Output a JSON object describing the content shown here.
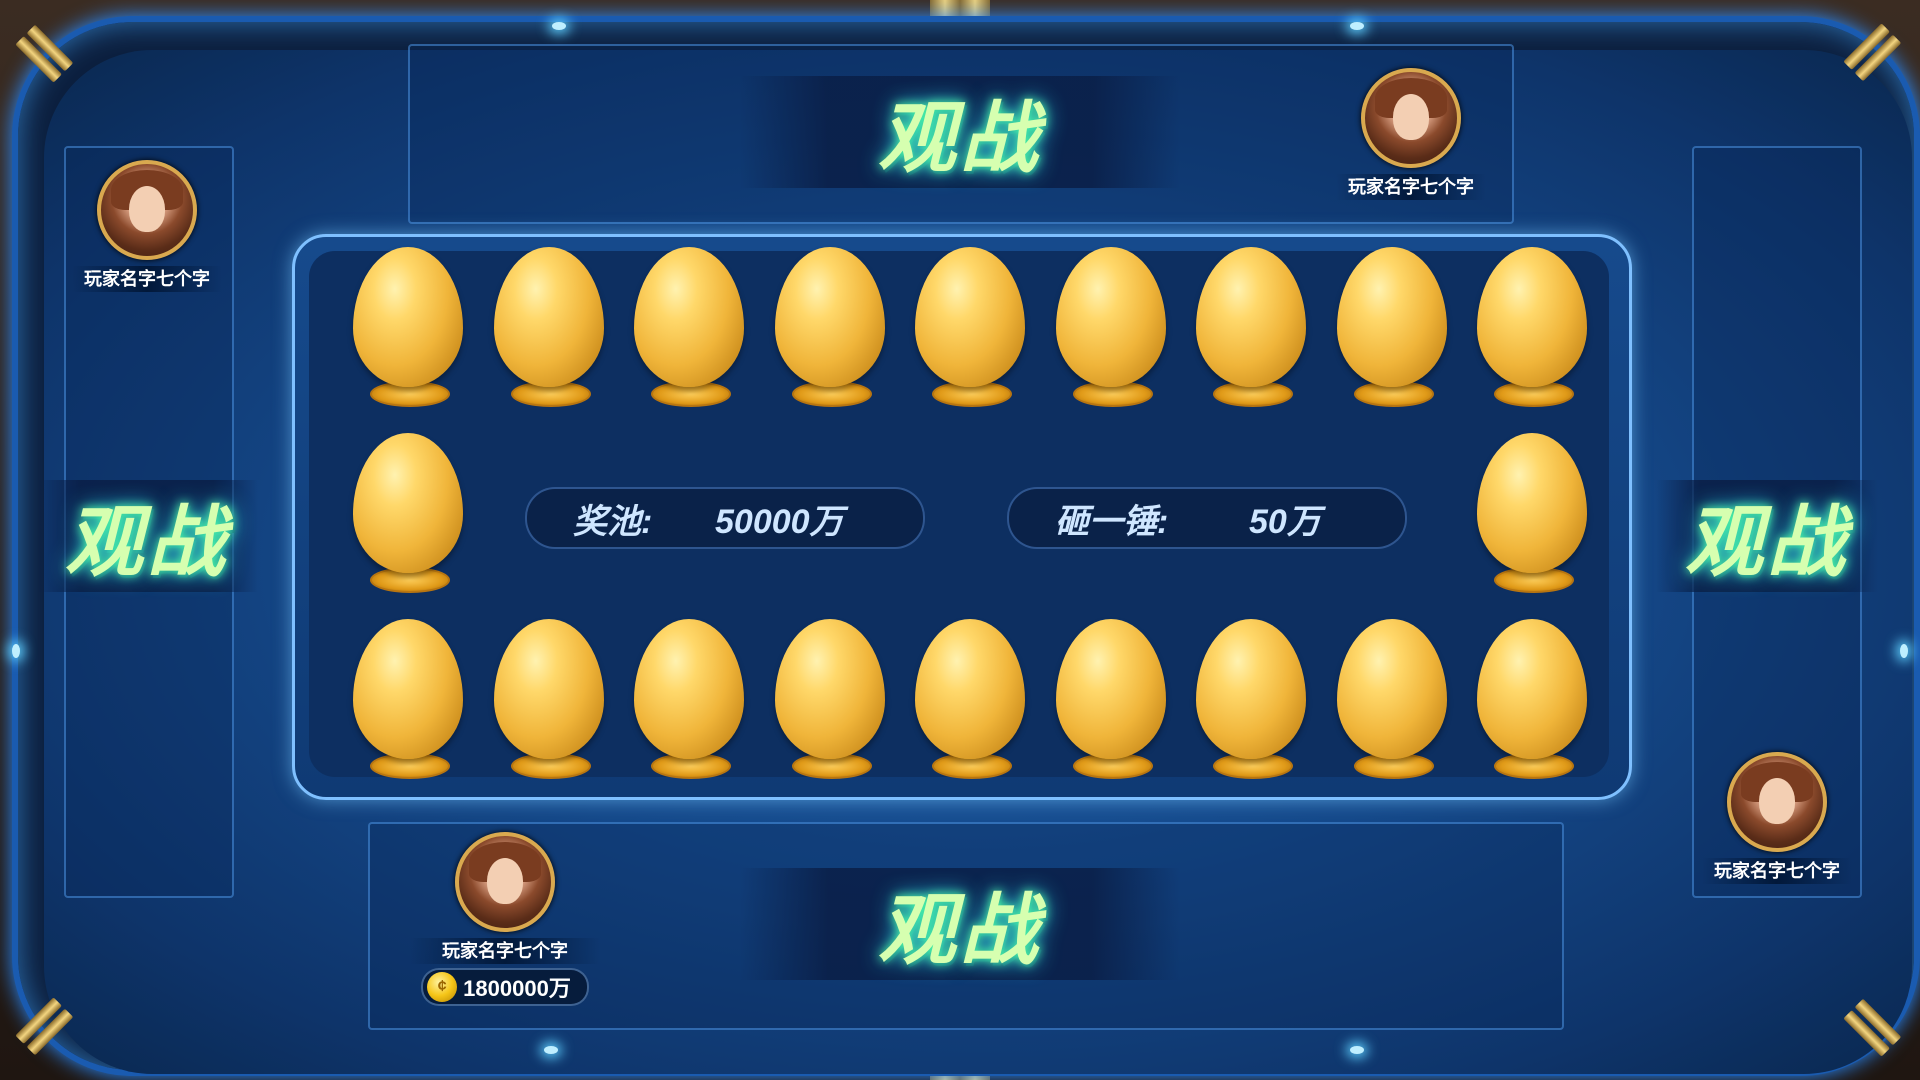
{
  "spectate_label": "观战",
  "players": {
    "top_right": {
      "name": "玩家名字七个字"
    },
    "left": {
      "name": "玩家名字七个字"
    },
    "right": {
      "name": "玩家名字七个字"
    },
    "bottom": {
      "name": "玩家名字七个字",
      "coins": "1800000万"
    }
  },
  "board": {
    "prize_pool_label": "奖池:",
    "prize_pool_value": "50000万",
    "per_smash_label": "砸一锤:",
    "per_smash_value": "50万",
    "egg_count": 20
  },
  "colors": {
    "egg": "#f0b53a",
    "spectate_text": "#d6ffb0",
    "accent": "#2a8cff"
  }
}
